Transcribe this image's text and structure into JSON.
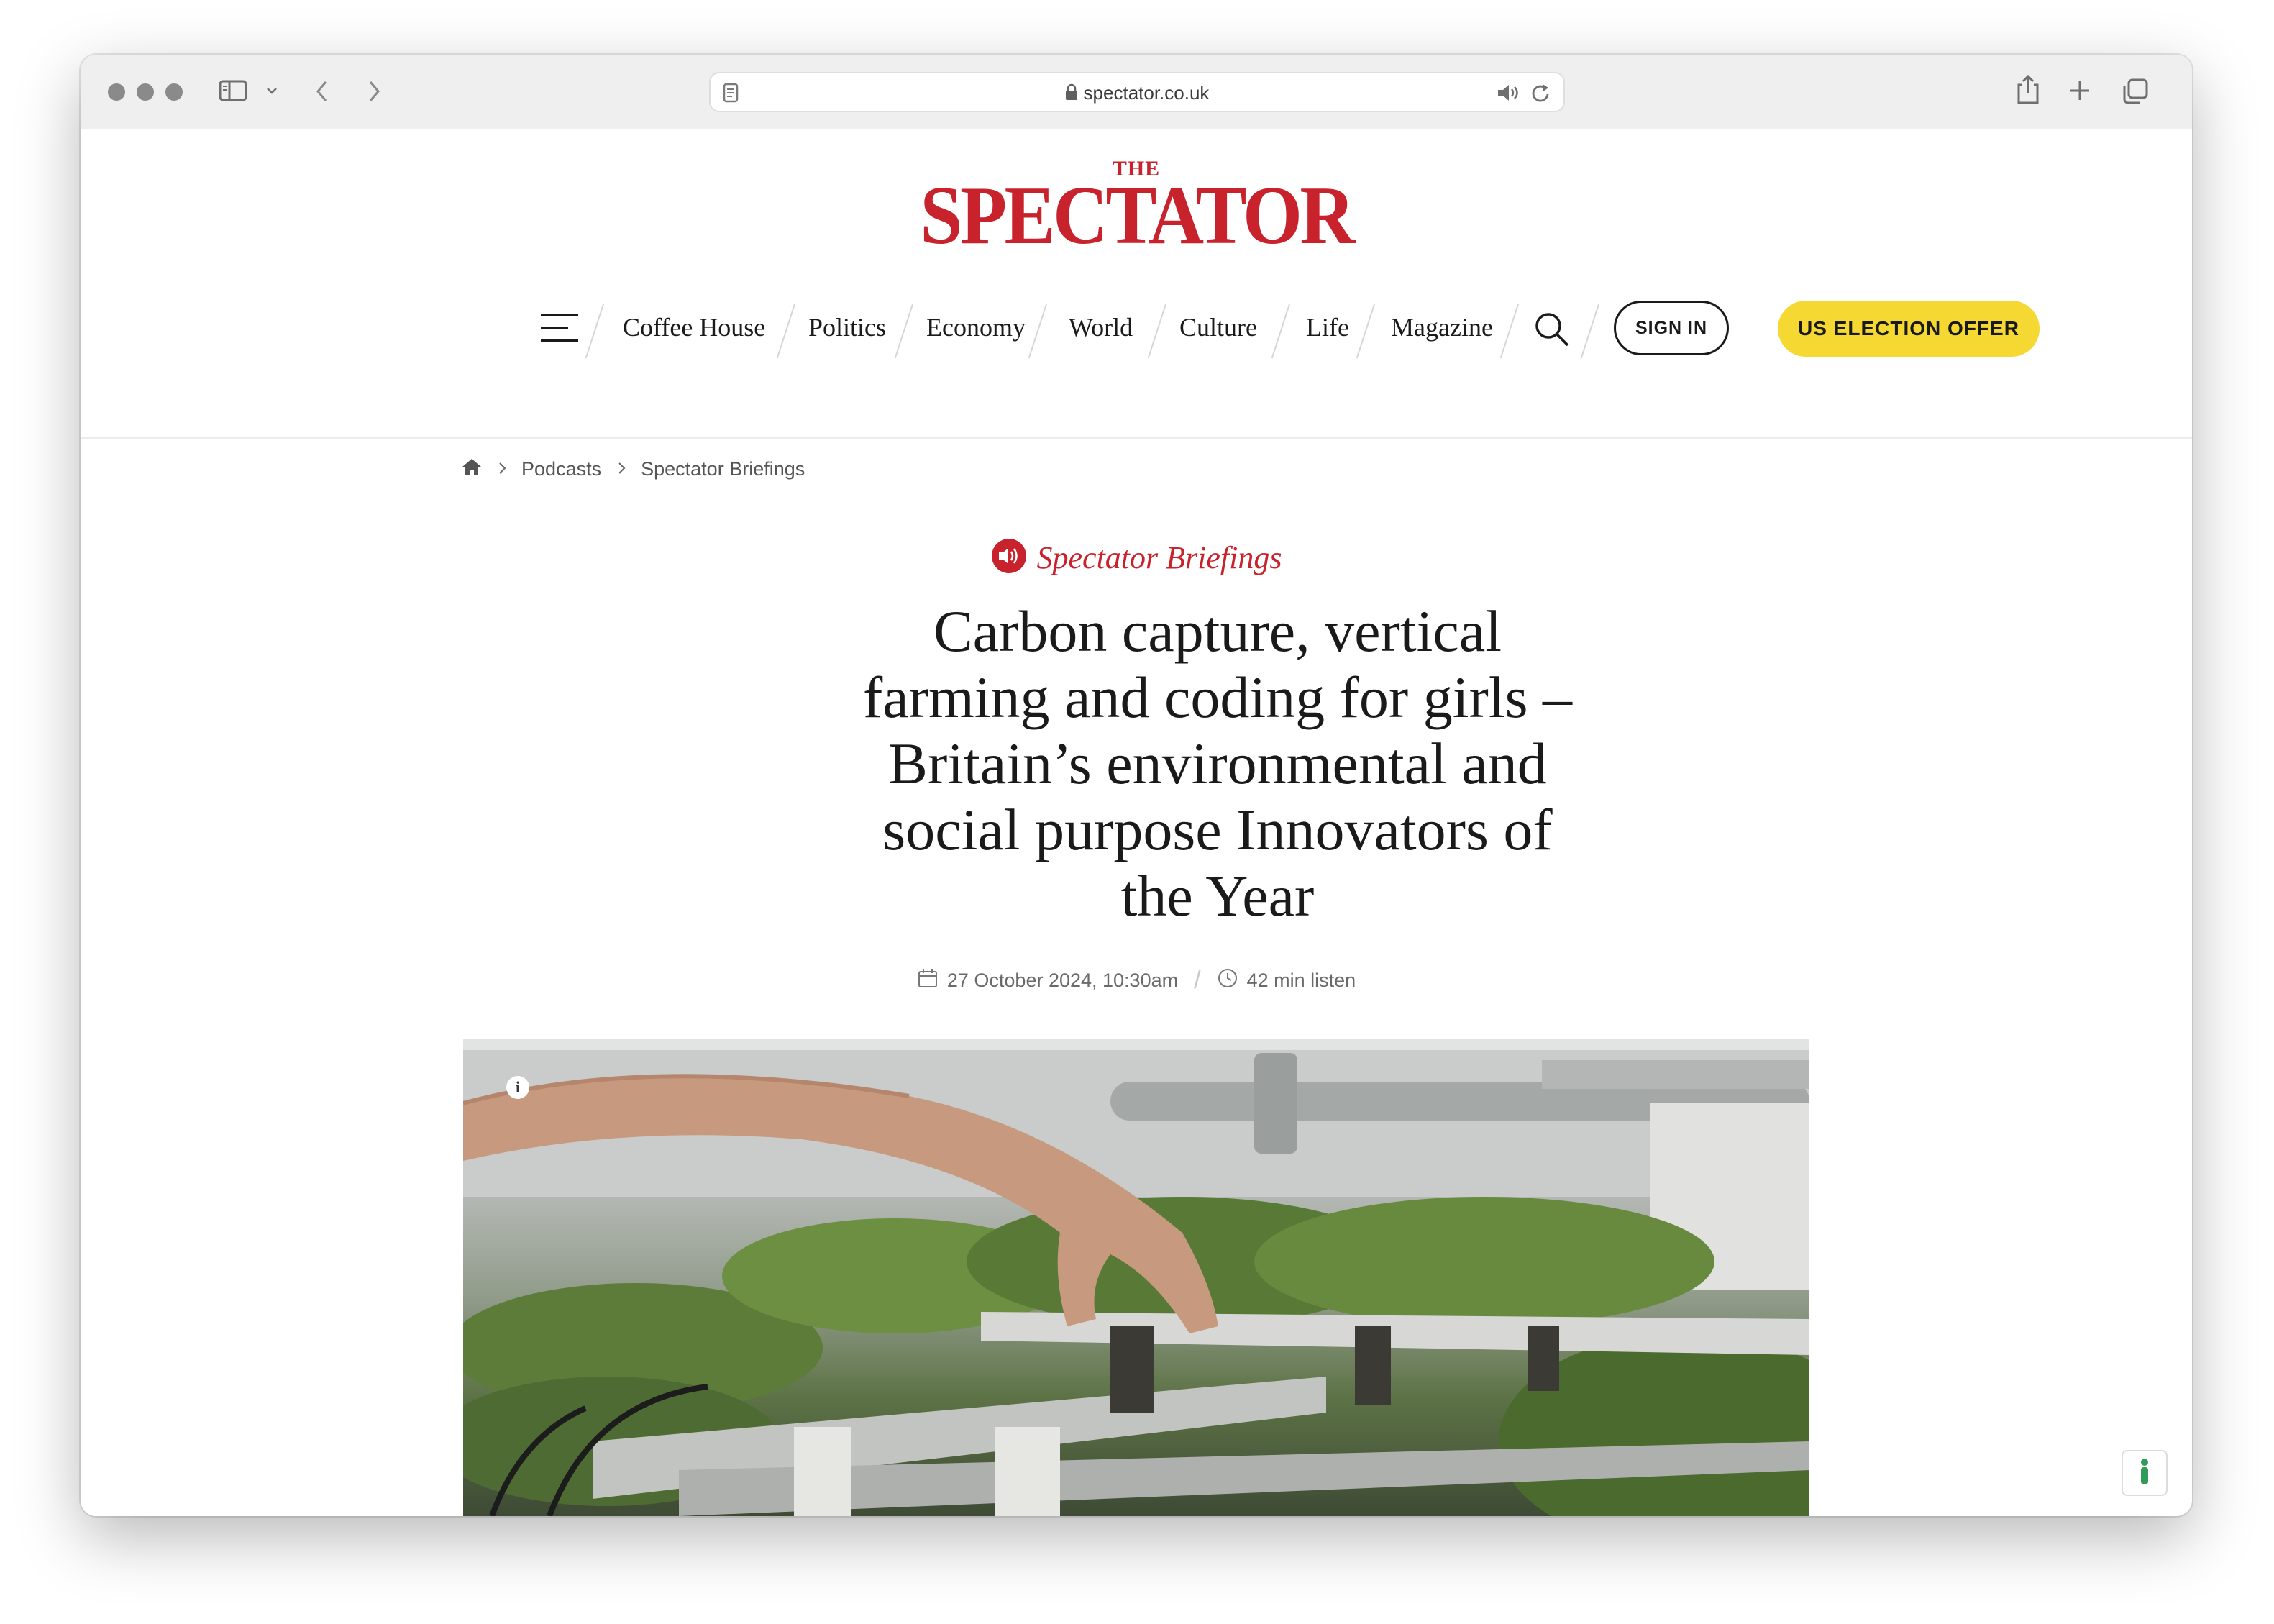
{
  "browser": {
    "url": "spectator.co.uk"
  },
  "site": {
    "logo_top": "THE",
    "logo_name": "SPECTATOR"
  },
  "nav": {
    "items": [
      "Coffee House",
      "Politics",
      "Economy",
      "World",
      "Culture",
      "Life",
      "Magazine"
    ],
    "sign_in": "SIGN IN",
    "offer": "US ELECTION OFFER"
  },
  "breadcrumb": {
    "items": [
      "Podcasts",
      "Spectator Briefings"
    ]
  },
  "article": {
    "section": "Spectator Briefings",
    "headline_lines": [
      "Carbon capture, vertical",
      "farming and coding for girls –",
      "Britain’s environmental and",
      "social purpose Innovators of",
      "the Year"
    ],
    "date": "27 October 2024, 10:30am",
    "duration": "42 min listen",
    "image_info": "i"
  },
  "colors": {
    "brand_red": "#c8232c",
    "offer_yellow": "#f6d832"
  },
  "icons": [
    "sidebar-icon",
    "chevron-down-icon",
    "back-icon",
    "forward-icon",
    "reader-icon",
    "lock-icon",
    "speaker-icon",
    "reload-icon",
    "share-icon",
    "new-tab-icon",
    "tabs-icon",
    "hamburger-icon",
    "search-icon",
    "home-icon",
    "calendar-icon",
    "clock-icon",
    "audio-icon",
    "info-icon"
  ]
}
